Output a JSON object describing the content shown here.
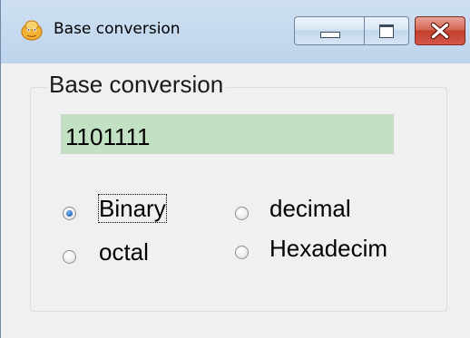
{
  "window": {
    "title": "Base conversion"
  },
  "group": {
    "label": "Base conversion"
  },
  "input": {
    "value": "1101111",
    "background_color": "#c2e0c2"
  },
  "radios": {
    "binary": {
      "label": "Binary",
      "checked": true
    },
    "decimal": {
      "label": "decimal",
      "checked": false
    },
    "octal": {
      "label": "octal",
      "checked": false
    },
    "hexadecimal": {
      "label": "Hexadecim",
      "checked": false
    }
  },
  "icons": {
    "app": "app-icon",
    "minimize": "minimize-icon",
    "maximize": "maximize-icon",
    "close": "close-icon"
  },
  "colors": {
    "close_button": "#c0402b",
    "radio_checked": "#2a6fc4"
  }
}
